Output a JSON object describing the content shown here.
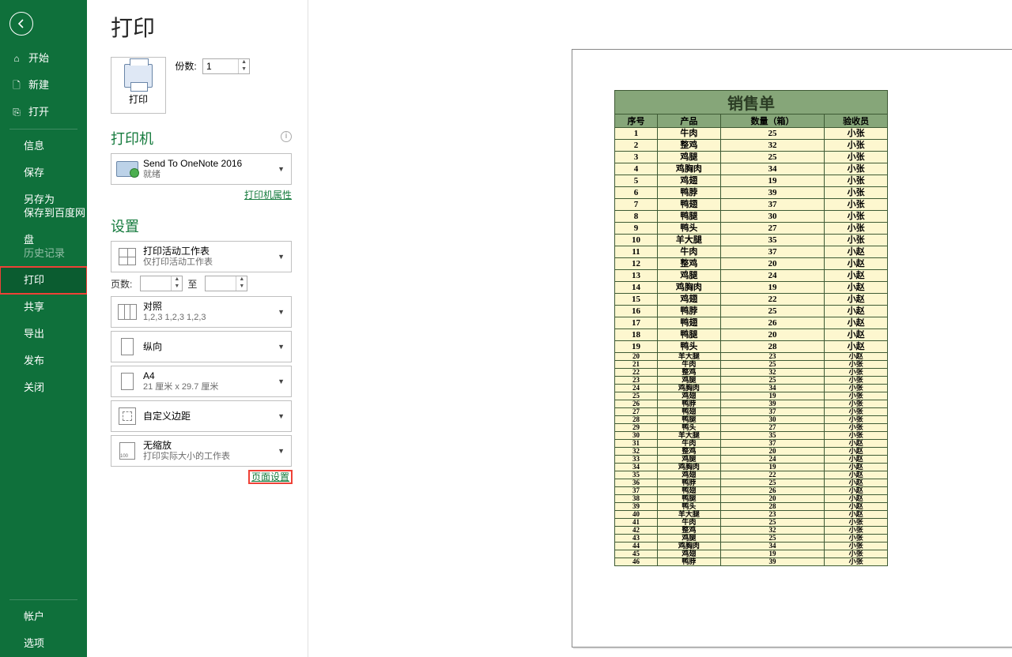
{
  "title": "打印",
  "sidebar": {
    "items": [
      {
        "icon": "⌂",
        "label": "开始"
      },
      {
        "icon": "🗋",
        "label": "新建"
      },
      {
        "icon": "⎘",
        "label": "打开"
      }
    ],
    "items2": [
      {
        "label": "信息"
      },
      {
        "label": "保存"
      },
      {
        "label": "另存为"
      },
      {
        "label": "保存到百度网盘"
      },
      {
        "label": "历史记录"
      },
      {
        "label": "打印"
      },
      {
        "label": "共享"
      },
      {
        "label": "导出"
      },
      {
        "label": "发布"
      },
      {
        "label": "关闭"
      }
    ],
    "bottom": [
      {
        "label": "帐户"
      },
      {
        "label": "选项"
      }
    ]
  },
  "print_button_label": "打印",
  "copies_label": "份数:",
  "copies_value": "1",
  "printer_header": "打印机",
  "printer": {
    "name": "Send To OneNote 2016",
    "status": "就绪"
  },
  "printer_props_link": "打印机属性",
  "settings_header": "设置",
  "setting_sheets": {
    "main": "打印活动工作表",
    "sub": "仅打印活动工作表"
  },
  "pages_label": "页数:",
  "pages_to": "至",
  "setting_collate": {
    "main": "对照",
    "sub": "1,2,3    1,2,3    1,2,3"
  },
  "setting_orient": {
    "main": "纵向"
  },
  "setting_paper": {
    "main": "A4",
    "sub": "21 厘米 x 29.7 厘米"
  },
  "setting_margins": {
    "main": "自定义边距"
  },
  "setting_scale": {
    "main": "无缩放",
    "sub": "打印实际大小的工作表"
  },
  "page_setup_link": "页面设置",
  "sales": {
    "title": "销售单",
    "cols": [
      "序号",
      "产品",
      "数量（箱）",
      "验收员"
    ],
    "rows": [
      [
        "1",
        "牛肉",
        "25",
        "小张"
      ],
      [
        "2",
        "整鸡",
        "32",
        "小张"
      ],
      [
        "3",
        "鸡腿",
        "25",
        "小张"
      ],
      [
        "4",
        "鸡胸肉",
        "34",
        "小张"
      ],
      [
        "5",
        "鸡翅",
        "19",
        "小张"
      ],
      [
        "6",
        "鸭脖",
        "39",
        "小张"
      ],
      [
        "7",
        "鸭翅",
        "37",
        "小张"
      ],
      [
        "8",
        "鸭腿",
        "30",
        "小张"
      ],
      [
        "9",
        "鸭头",
        "27",
        "小张"
      ],
      [
        "10",
        "羊大腿",
        "35",
        "小张"
      ],
      [
        "11",
        "牛肉",
        "37",
        "小赵"
      ],
      [
        "12",
        "整鸡",
        "20",
        "小赵"
      ],
      [
        "13",
        "鸡腿",
        "24",
        "小赵"
      ],
      [
        "14",
        "鸡胸肉",
        "19",
        "小赵"
      ],
      [
        "15",
        "鸡翅",
        "22",
        "小赵"
      ],
      [
        "16",
        "鸭脖",
        "25",
        "小赵"
      ],
      [
        "17",
        "鸭翅",
        "26",
        "小赵"
      ],
      [
        "18",
        "鸭腿",
        "20",
        "小赵"
      ],
      [
        "19",
        "鸭头",
        "28",
        "小赵"
      ],
      [
        "20",
        "羊大腿",
        "23",
        "小赵"
      ],
      [
        "21",
        "牛肉",
        "25",
        "小张"
      ],
      [
        "22",
        "整鸡",
        "32",
        "小张"
      ],
      [
        "23",
        "鸡腿",
        "25",
        "小张"
      ],
      [
        "24",
        "鸡胸肉",
        "34",
        "小张"
      ],
      [
        "25",
        "鸡翅",
        "19",
        "小张"
      ],
      [
        "26",
        "鸭脖",
        "39",
        "小张"
      ],
      [
        "27",
        "鸭翅",
        "37",
        "小张"
      ],
      [
        "28",
        "鸭腿",
        "30",
        "小张"
      ],
      [
        "29",
        "鸭头",
        "27",
        "小张"
      ],
      [
        "30",
        "羊大腿",
        "35",
        "小张"
      ],
      [
        "31",
        "牛肉",
        "37",
        "小赵"
      ],
      [
        "32",
        "整鸡",
        "20",
        "小赵"
      ],
      [
        "33",
        "鸡腿",
        "24",
        "小赵"
      ],
      [
        "34",
        "鸡胸肉",
        "19",
        "小赵"
      ],
      [
        "35",
        "鸡翅",
        "22",
        "小赵"
      ],
      [
        "36",
        "鸭脖",
        "25",
        "小赵"
      ],
      [
        "37",
        "鸭翅",
        "26",
        "小赵"
      ],
      [
        "38",
        "鸭腿",
        "20",
        "小赵"
      ],
      [
        "39",
        "鸭头",
        "28",
        "小赵"
      ],
      [
        "40",
        "羊大腿",
        "23",
        "小赵"
      ],
      [
        "41",
        "牛肉",
        "25",
        "小张"
      ],
      [
        "42",
        "整鸡",
        "32",
        "小张"
      ],
      [
        "43",
        "鸡腿",
        "25",
        "小张"
      ],
      [
        "44",
        "鸡胸肉",
        "34",
        "小张"
      ],
      [
        "45",
        "鸡翅",
        "19",
        "小张"
      ],
      [
        "46",
        "鸭脖",
        "39",
        "小张"
      ]
    ]
  }
}
